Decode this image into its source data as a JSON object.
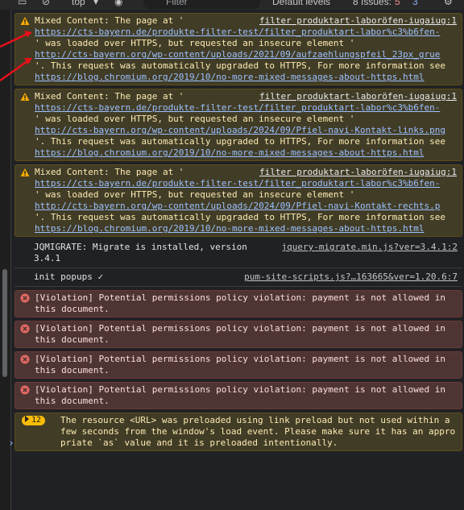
{
  "toolbar": {
    "context": "top",
    "filter_placeholder": "Filter",
    "levels": "Default levels",
    "issues_label": "8 Issues:",
    "issues_warn": "5",
    "issues_info": "3"
  },
  "messages": [
    {
      "prefix": "Mixed Content: The page at '",
      "source": "filter produktart-laboröfen-iugaiug:1",
      "page_url": "https://cts-bayern.de/produkte-filter-test/filter_produktart-labor%c3%b6fen-",
      "mid": "' was loaded over HTTPS, but requested an insecure element '",
      "resource": "http://cts-bayern.org/wp-content/uploads/2021/09/aufzaehlungspfeil_23px_grue",
      "suffix": "'. This request was automatically upgraded to HTTPS, For more information see",
      "blog": "https://blog.chromium.org/2019/10/no-more-mixed-messages-about-https.html"
    },
    {
      "prefix": "Mixed Content: The page at '",
      "source": "filter produktart-laboröfen-iugaiug:1",
      "page_url": "https://cts-bayern.de/produkte-filter-test/filter_produktart-labor%c3%b6fen-",
      "mid": "' was loaded over HTTPS, but requested an insecure element '",
      "resource": "http://cts-bayern.org/wp-content/uploads/2024/09/Pfiel-navi-Kontakt-links.png",
      "suffix": "'. This request was automatically upgraded to HTTPS, For more information see",
      "blog": "https://blog.chromium.org/2019/10/no-more-mixed-messages-about-https.html"
    },
    {
      "prefix": "Mixed Content: The page at '",
      "source": "filter produktart-laboröfen-iugaiug:1",
      "page_url": "https://cts-bayern.de/produkte-filter-test/filter_produktart-labor%c3%b6fen-",
      "mid": "' was loaded over HTTPS, but requested an insecure element '",
      "resource": "http://cts-bayern.org/wp-content/uploads/2024/09/Pfiel-navi-Kontakt-rechts.p",
      "suffix": "'. This request was automatically upgraded to HTTPS, For more information see",
      "blog": "https://blog.chromium.org/2019/10/no-more-mixed-messages-about-https.html"
    }
  ],
  "jqmigrate": {
    "text": "JQMIGRATE: Migrate is installed, version",
    "version": "3.4.1",
    "source": "jquery-migrate.min.js?ver=3.4.1:2"
  },
  "popups": {
    "text": "init popups ✓",
    "source": "pum-site-scripts.js?…163665&ver=1.20.6:7"
  },
  "violations": [
    {
      "line1": "[Violation] Potential permissions policy violation: payment is not allowed in",
      "line2": "this document."
    },
    {
      "line1": "[Violation] Potential permissions policy violation: payment is not allowed in",
      "line2": "this document."
    },
    {
      "line1": "[Violation] Potential permissions policy violation: payment is not allowed in",
      "line2": "this document."
    },
    {
      "line1": "[Violation] Potential permissions policy violation: payment is not allowed in",
      "line2": "this document."
    }
  ],
  "preload": {
    "count": "12",
    "text": "The resource <URL> was preloaded using link preload but not used within a few seconds from the window's load event. Please make sure it has an appropriate `as` value and it is preloaded intentionally."
  },
  "prompt": "›",
  "colors": {
    "warning_bg": "#413c26",
    "error_bg": "#4e3534",
    "link": "#9cc1ff",
    "annotation_arrow": "#e8101b"
  }
}
